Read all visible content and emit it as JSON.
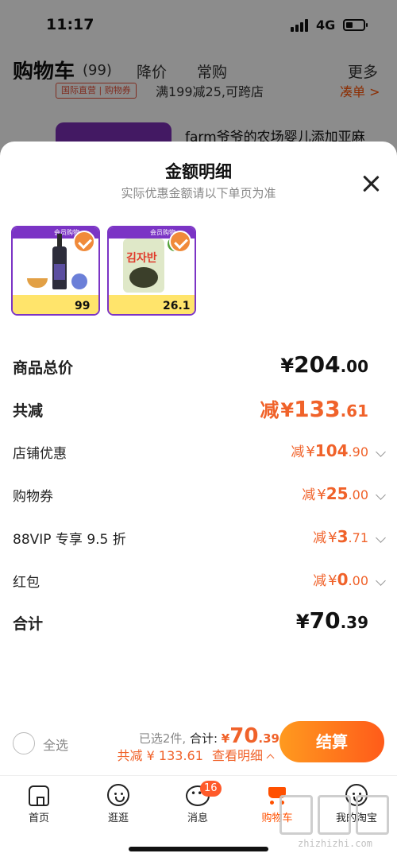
{
  "status_bar": {
    "time": "11:17",
    "network": "4G"
  },
  "cart_header": {
    "title": "购物车",
    "count": "(99)",
    "tabs": [
      "降价",
      "常购"
    ],
    "more": "更多"
  },
  "bg_promo": {
    "tag": "国际直营 | 购物券",
    "text": "满199减25,可跨店",
    "link": "凑单 >"
  },
  "bg_item": {
    "title": "farm爷爷的农场婴儿添加亚麻"
  },
  "sheet": {
    "title": "金额明细",
    "subtitle": "实际优惠金额请以下单页为准",
    "products": [
      {
        "price": "99",
        "icon": "oil-bottle-image"
      },
      {
        "price": "26.1",
        "icon": "seaweed-snack-image"
      }
    ],
    "rows": [
      {
        "label": "商品总价",
        "prefix": "",
        "currency": "¥",
        "int": "204",
        "dec": ".00",
        "style": "total"
      },
      {
        "label": "共减",
        "prefix": "减",
        "currency": "¥",
        "int": "133",
        "dec": ".61",
        "style": "discount-total"
      },
      {
        "label": "店铺优惠",
        "prefix": "减",
        "currency": "¥",
        "int": "104",
        "dec": ".90",
        "style": "discount"
      },
      {
        "label": "购物券",
        "prefix": "减",
        "currency": "¥",
        "int": "25",
        "dec": ".00",
        "style": "discount"
      },
      {
        "label": "88VIP 专享 9.5 折",
        "prefix": "减",
        "currency": "¥",
        "int": "3",
        "dec": ".71",
        "style": "discount"
      },
      {
        "label": "红包",
        "prefix": "减",
        "currency": "¥",
        "int": "0",
        "dec": ".00",
        "style": "discount"
      },
      {
        "label": "合计",
        "prefix": "",
        "currency": "¥",
        "int": "70",
        "dec": ".39",
        "style": "total"
      }
    ]
  },
  "summary": {
    "select_all": "全选",
    "selected_text": "已选2件,",
    "total_label": "合计:",
    "total_currency": "¥",
    "total_int": "70",
    "total_dec": ".39",
    "discount_line": "共减 ¥ 133.61",
    "detail_link": "查看明细",
    "checkout": "结算"
  },
  "tabbar": {
    "items": [
      {
        "label": "首页",
        "icon": "home-icon"
      },
      {
        "label": "逛逛",
        "icon": "explore-icon"
      },
      {
        "label": "消息",
        "icon": "message-icon",
        "badge": "16"
      },
      {
        "label": "购物车",
        "icon": "cart-icon"
      },
      {
        "label": "我的淘宝",
        "icon": "profile-icon"
      }
    ]
  },
  "watermark": "zhizhizhi.com",
  "colors": {
    "accent": "#ff5000",
    "discount": "#f0622a",
    "badge_purple": "#7b34c5"
  }
}
